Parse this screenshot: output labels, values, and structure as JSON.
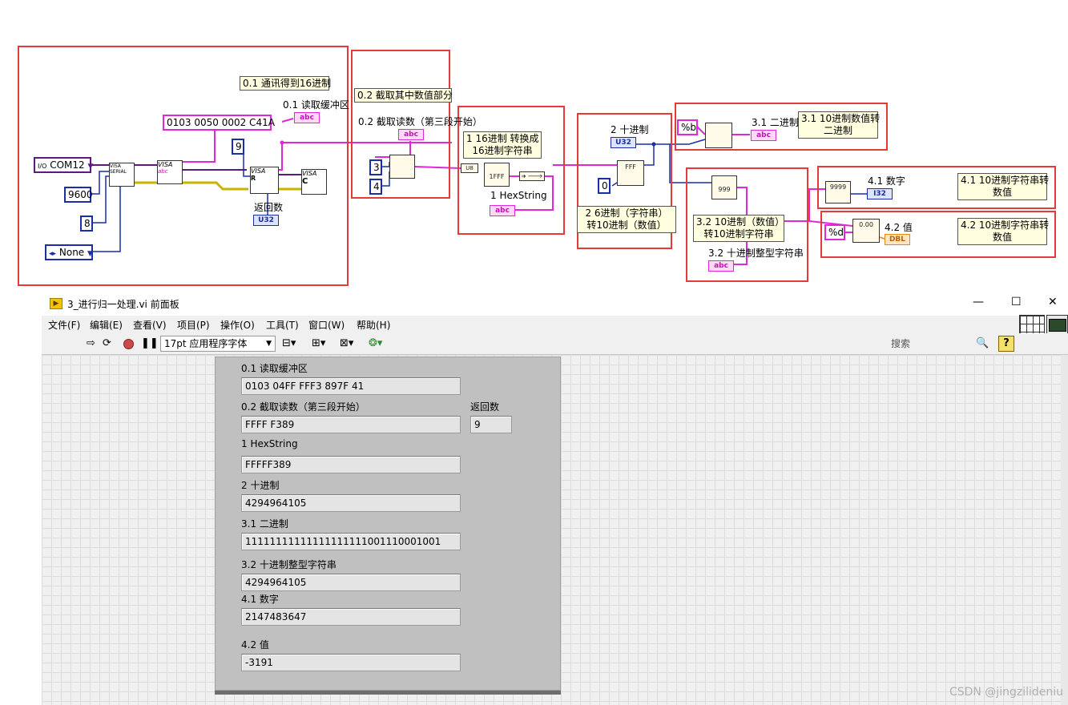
{
  "diagram": {
    "notes": {
      "n01": "0.1 通讯得到16进制",
      "n02": "0.2 截取其中数值部分",
      "n1a": "1 16进制 转换成",
      "n1b": "16进制字符串",
      "n2a": "2 6进制（字符串）",
      "n2b": "转10进制（数值）",
      "n31a": "3.1 10进制数值转",
      "n31b": "二进制",
      "n32a": "3.2 10进制（数值）",
      "n32b": "转10进制字符串",
      "n41a": "4.1 10进制字符串转",
      "n41b": "数值",
      "n42a": "4.2 10进制字符串转",
      "n42b": "数值"
    },
    "labels": {
      "read_buffer": "0.1 读取缓冲区",
      "cut_read": "0.2 截取读数（第三段开始）",
      "return_count": "返回数",
      "hexstring": "1 HexString",
      "decimal": "2 十进制",
      "binary": "3.1 二进制",
      "dec_int_str": "3.2 十进制整型字符串",
      "number": "4.1 数字",
      "value": "4.2 值"
    },
    "constants": {
      "com": "COM12",
      "baud": "9600",
      "databits": "8",
      "parity": "None",
      "write_str": "0103 0050 0002 C41A",
      "bytes": "9",
      "offset": "3",
      "length": "4",
      "zero": "0",
      "fmt_b": "%b",
      "fmt_d": "%d",
      "visa_res": "I/O"
    },
    "terminals": {
      "abc": "abc",
      "u32": "U32",
      "i32": "I32",
      "dbl": "DBL",
      "visa_serial": "VISA SERIAL",
      "visa": "VISA",
      "abc_w": "abc",
      "visa_r": "R",
      "visa_c": "C",
      "fff": "FFF",
      "hex1fff": "1FFF",
      "n999": "999",
      "n9999": "9999",
      "n000": "0.00"
    }
  },
  "window": {
    "title": "3_进行归一处理.vi 前面板",
    "controls": {
      "minimize": "—",
      "maximize": "☐",
      "close": "✕"
    },
    "menu": [
      "文件(F)",
      "编辑(E)",
      "查看(V)",
      "项目(P)",
      "操作(O)",
      "工具(T)",
      "窗口(W)",
      "帮助(H)"
    ],
    "font_select": "17pt 应用程序字体",
    "search_placeholder": "搜索",
    "help": "?"
  },
  "panel": {
    "fields": [
      {
        "label": "0.1 读取缓冲区",
        "value": "0103 04FF FFF3 897F 41"
      },
      {
        "label": "0.2 截取读数（第三段开始）",
        "value": "FFFF F389"
      },
      {
        "label": "返回数",
        "value": "9"
      },
      {
        "label": "1 HexString",
        "value": "FFFFF389"
      },
      {
        "label": "2 十进制",
        "value": "4294964105"
      },
      {
        "label": "3.1 二进制",
        "value": "11111111111111111111001110001001"
      },
      {
        "label": "3.2 十进制整型字符串",
        "value": "4294964105"
      },
      {
        "label": "4.1 数字",
        "value": "2147483647"
      },
      {
        "label": "4.2 值",
        "value": "-3191"
      }
    ]
  },
  "watermark": "CSDN @jingzilideniu",
  "colors": {
    "red_box": "#e53a3a",
    "string_wire": "#e028d8",
    "numeric_wire": "#1a2ea8",
    "visa_wire": "#5c1a7c"
  }
}
